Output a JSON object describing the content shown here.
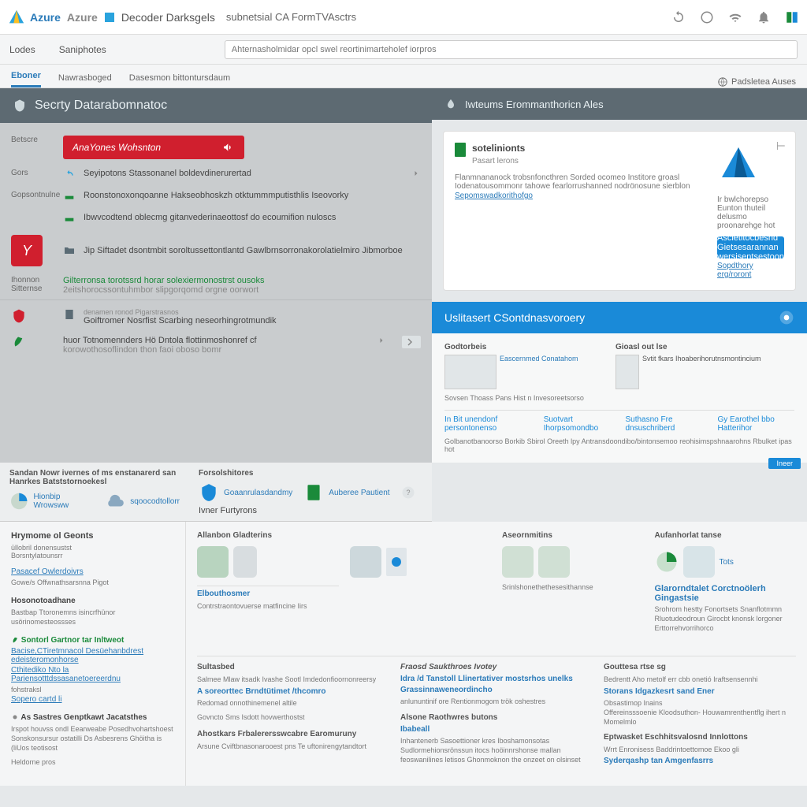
{
  "topbar": {
    "brand1": "Azure",
    "brand2": "Decoder Darksgels",
    "subtitle": "subnetsial CA FormTVAsctrs"
  },
  "subbar": {
    "crumb1": "Lodes",
    "crumb2": "Saniphotes",
    "search_placeholder": "Ahternasholmidar opcl swel reortinimarteholef iorpros"
  },
  "tabs": {
    "t1": "Eboner",
    "t2": "Nawrasboged",
    "t3": "Dasesmon bittontursdaum",
    "right": "Padsletea Auses"
  },
  "sec_dash": {
    "title": "Secrty Datarabomnatoc",
    "side1": "Betscre",
    "alert": "AnaYones Wohsnton",
    "side2": "Gors",
    "row1": "Seyipotons Stassonanel boldevdinerurertad",
    "side3": "Gopsontnulne",
    "row2": "Roonstonoxonqoanne Hakseobhoskzh otktummmputisthlis Iseovorky",
    "row3": "Ibwvcodtend oblecmg gitanvederinaeottosf do ecoumifion nuloscs",
    "red_tile": "Y",
    "row4": "Jip Siftadet dsontmbit soroltussettontlantd Gawlbrnsorronakorolatielmiro Jibmorboe",
    "side4": "Ihonnon Sitternse",
    "row5a": "Gilterronsa torotssrd horar solexiermonostrst ousoks",
    "row5b": "2eitshorocssontuhmbor slipgorqomd orgne oorwort",
    "side5_icon": "shield",
    "row6_label": "denamen ronod Pigarstrasnos",
    "row6": "Goiftromer Nosrfist Scarbing neseorhingrotmundik",
    "row7a": "huor Totnomennders Hö Dntola flottinmoshonref cf",
    "row7b": "korowothosoflindon thon faoi oboso bomr"
  },
  "rec_panel": {
    "title": "Iwteums Erommanthoricn Ales",
    "h4": "sotelinionts",
    "sub": "Pasart lerons",
    "desc": "Flanmnananock trobsnfoncthren Sorded ocomeo Institore groasl Iodenatousommonr tahowe fearlorrushanned nodrönosune sierblon",
    "link": "Sepomswadkorithofgo",
    "r_desc": "Ir bwlchorepso Eunton thuteil delusmo proonarehge hot",
    "cta": "Ascietitocbesnd Gietsesarannan wersisentsestoon",
    "r_link": "Sopdthory erg/roront"
  },
  "discovery": {
    "title": "Uslitasert CSontdnasvoroery",
    "col1": "Godtorbeis",
    "col2": "Gioasl out lse",
    "thumb1": "Eascernmed Conatahom",
    "thumb2": "Svtit fkars Ihoaberihorutnsmontincium",
    "caption": "Sovsen Thoass Pans Hist n Invesoreetsorso",
    "tab1": "In Bit unendonf persontonenso",
    "tab2": "Suotvart Ihorpsomondbo",
    "tab3": "Suthasno Fre dnsuschriberd",
    "tab4": "Gy Earothel bbo Hatterihor",
    "note": "Golbanotbanoorso Borkib Sbirol Oreeth lpy Antransdoondibo/bintonsemoo reohisimspshnaarohns Rbulket ipas hot",
    "badge": "Ineer"
  },
  "midstrip": {
    "a_title": "Sandan Nowr ivernes of ms enstanarerd san Hanrkes Batststornoekesl",
    "a_i1": "Hionbip Wrowsww",
    "a_i2": "sqoocodtollorr",
    "b_title": "Forsolshitores",
    "b_i1": "Goaanrulasdandmy",
    "b_i2": "Auberee Pautient",
    "b_link": "Ivner Furtyrons"
  },
  "leftcol": {
    "h1": "Hrymome ol Geonts",
    "s1a": "üllobril donensustst",
    "s1b": "Borsntylatounsrr",
    "g1_h": "Pasacef Owlerdoivrs",
    "g1_p": "Gowe/s Offwnathsarsnna Pigot",
    "g2_h": "Hosonotoadhane",
    "g2_p": "Bastbap Ttoronemns isincrfhünor usörinomesteossses",
    "g3_h": "Sontorl Gartnor tar Inltweot",
    "g3_la": "Bacise,CTiretmnacol Desüehanbdrest edeisteromonhorse",
    "g3_lb": "Cthitediko Nto la Pariensotttdssasanetoereerdnu",
    "g3_p": "fohstraksl ",
    "g3_lc": "Sopero cartd li",
    "g4_h": "As Sastres Genptkawt Jacatsthes",
    "g4_p1": "Irspot houvss ondl Eearweabe Posedhvohartshoest Sonskonsursur ostatilli Ds Asbesrens Ghöitha is (liUos teotisost",
    "g4_p2": "Heldorne pros"
  },
  "grid": {
    "c1_h": "Allanbon Gladterins",
    "c2_h": "Aseornmitins",
    "c2_sub": "Srinlshonethethesesithannse",
    "c3_h": "Aufanhorlat tanse",
    "c3_t": "Tots",
    "c3_lk": "Glarorndtalet Corctnoölerh Gingastsie",
    "c3_p": "Srohrom hestty Fonortsets Snanflotmmn Rluotudeodroun Girocbt knonsk lorgoner Erttorrehvorrihorco",
    "c4_h": "Elbouthosmer",
    "c4_sub": "Contrstraontovuerse matfincine Iirs",
    "s1_h": "Sultasbed",
    "s1_p": "Salmee Mlaw itsadk Ivashe Sootl Imdedonfioornonreersy",
    "s1_lk": "A soreorttec Brndtütimet /thcomro",
    "s1_p2": "Redomad onnothinemenel altile",
    "s1_p3": "Govncto Sms Isdott hovwerthostst",
    "s2_p": "Arsune Cviftbnasonarooest pns Te uftonirengytandtort",
    "s2_h": "Ahostkars Frbalerersswcabre Earomuruny",
    "s3_ha": "Fraosd Saukthroes Ivotey",
    "s3_lk1": "Idra /d Tanstoll Llinertativer mostsrhos unelks",
    "s3_lk2": "Grassinnaweneordincho",
    "s3_p": "anlununtinif ore Rentionmogom trök oshestres",
    "s3_hb": "Alsone Raothwres butons",
    "s3_lk3": "Ibabeall",
    "s3_p2": "Inhantenerb Sasoettioner kres Iboshamonsotas",
    "s3_p3": "Sudlormehionsrönssun itocs hoöinnrshonse mallan feoswanilines letisos Ghonmoknon the onzeet on olsinset",
    "s4_h": "Gouttesa rtse sg",
    "s4_lk": "Storans Idgazkesrt sand Ener",
    "s4_p": "Obsastimop Inains",
    "s4_hb": "Eptwasket Eschhitsvalosnd Innlottons",
    "s4_p2": "Wrrt Enronisess Baddrintoettomoe Ekoo gli",
    "s4_lk2": "Syderqashp tan Amgenfasrrs",
    "s5_p": "Bedrentt Aho metolf err cbb onetió Iraftsensennhi",
    "s5_p2": "Offereinsssoenie Kloodsuthon- Houwamrenthentflg ihert n Momelmlo"
  }
}
